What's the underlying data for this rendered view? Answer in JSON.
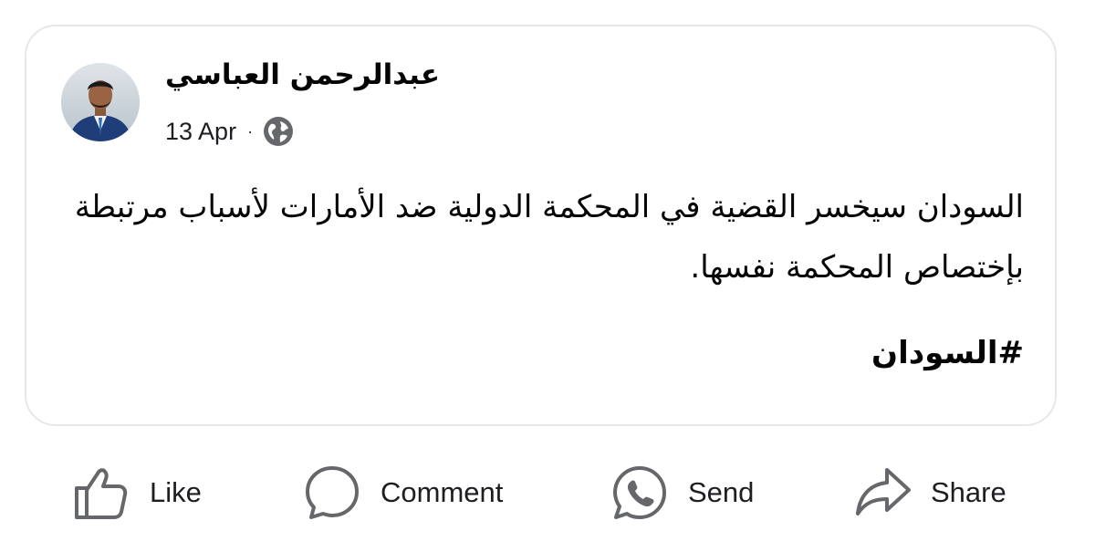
{
  "post": {
    "author_name": "عبدالرحمن العباسي",
    "date": "13 Apr",
    "separator": "·",
    "privacy_icon": "globe-icon",
    "body_line_1": "السودان سيخسر القضية في المحكمة الدولية ضد الأمارات لأسباب مرتبطة",
    "body_line_2": "بإختصاص المحكمة نفسها.",
    "hashtag": "#السودان"
  },
  "actions": {
    "like_label": "Like",
    "comment_label": "Comment",
    "send_label": "Send",
    "share_label": "Share"
  },
  "colors": {
    "text": "#050505",
    "icon": "#65676b",
    "card_border": "#e6e7eb"
  }
}
